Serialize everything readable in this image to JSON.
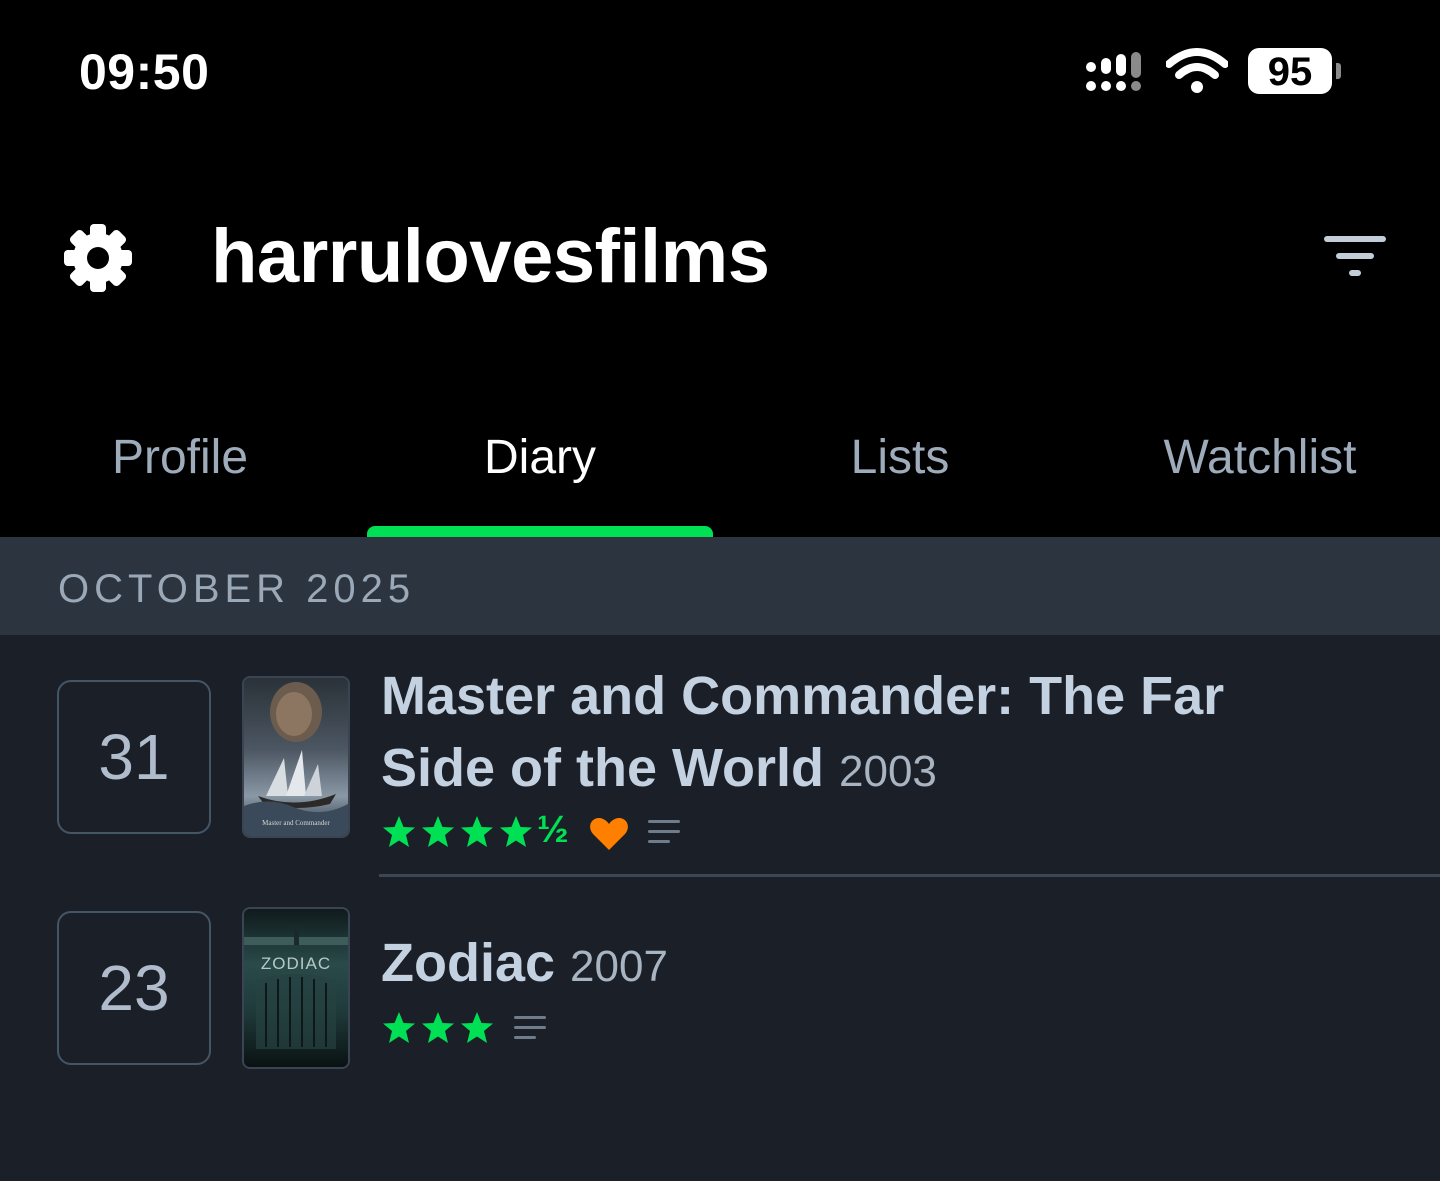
{
  "status_bar": {
    "time": "09:50",
    "battery": "95"
  },
  "header": {
    "username": "harrulovesfilms",
    "settings_icon": "gear-icon",
    "filter_icon": "filter-icon"
  },
  "tabs": [
    {
      "label": "Profile",
      "active": false
    },
    {
      "label": "Diary",
      "active": true
    },
    {
      "label": "Lists",
      "active": false
    },
    {
      "label": "Watchlist",
      "active": false
    }
  ],
  "colors": {
    "accent_green": "#00e054",
    "heart_orange": "#ff8000",
    "background": "#1b1f27"
  },
  "diary": {
    "month": "OCTOBER 2025",
    "entries": [
      {
        "day": "31",
        "title_line1": "Master and Commander: The Far",
        "title_line2": "Side of the World",
        "year": "2003",
        "rating": 4.5,
        "rating_half_glyph": "½",
        "liked": true,
        "has_review": true,
        "poster_text": "Master and Commander"
      },
      {
        "day": "23",
        "title": "Zodiac",
        "year": "2007",
        "rating": 3,
        "liked": false,
        "has_review": true,
        "poster_text": "ZODIAC"
      }
    ]
  }
}
